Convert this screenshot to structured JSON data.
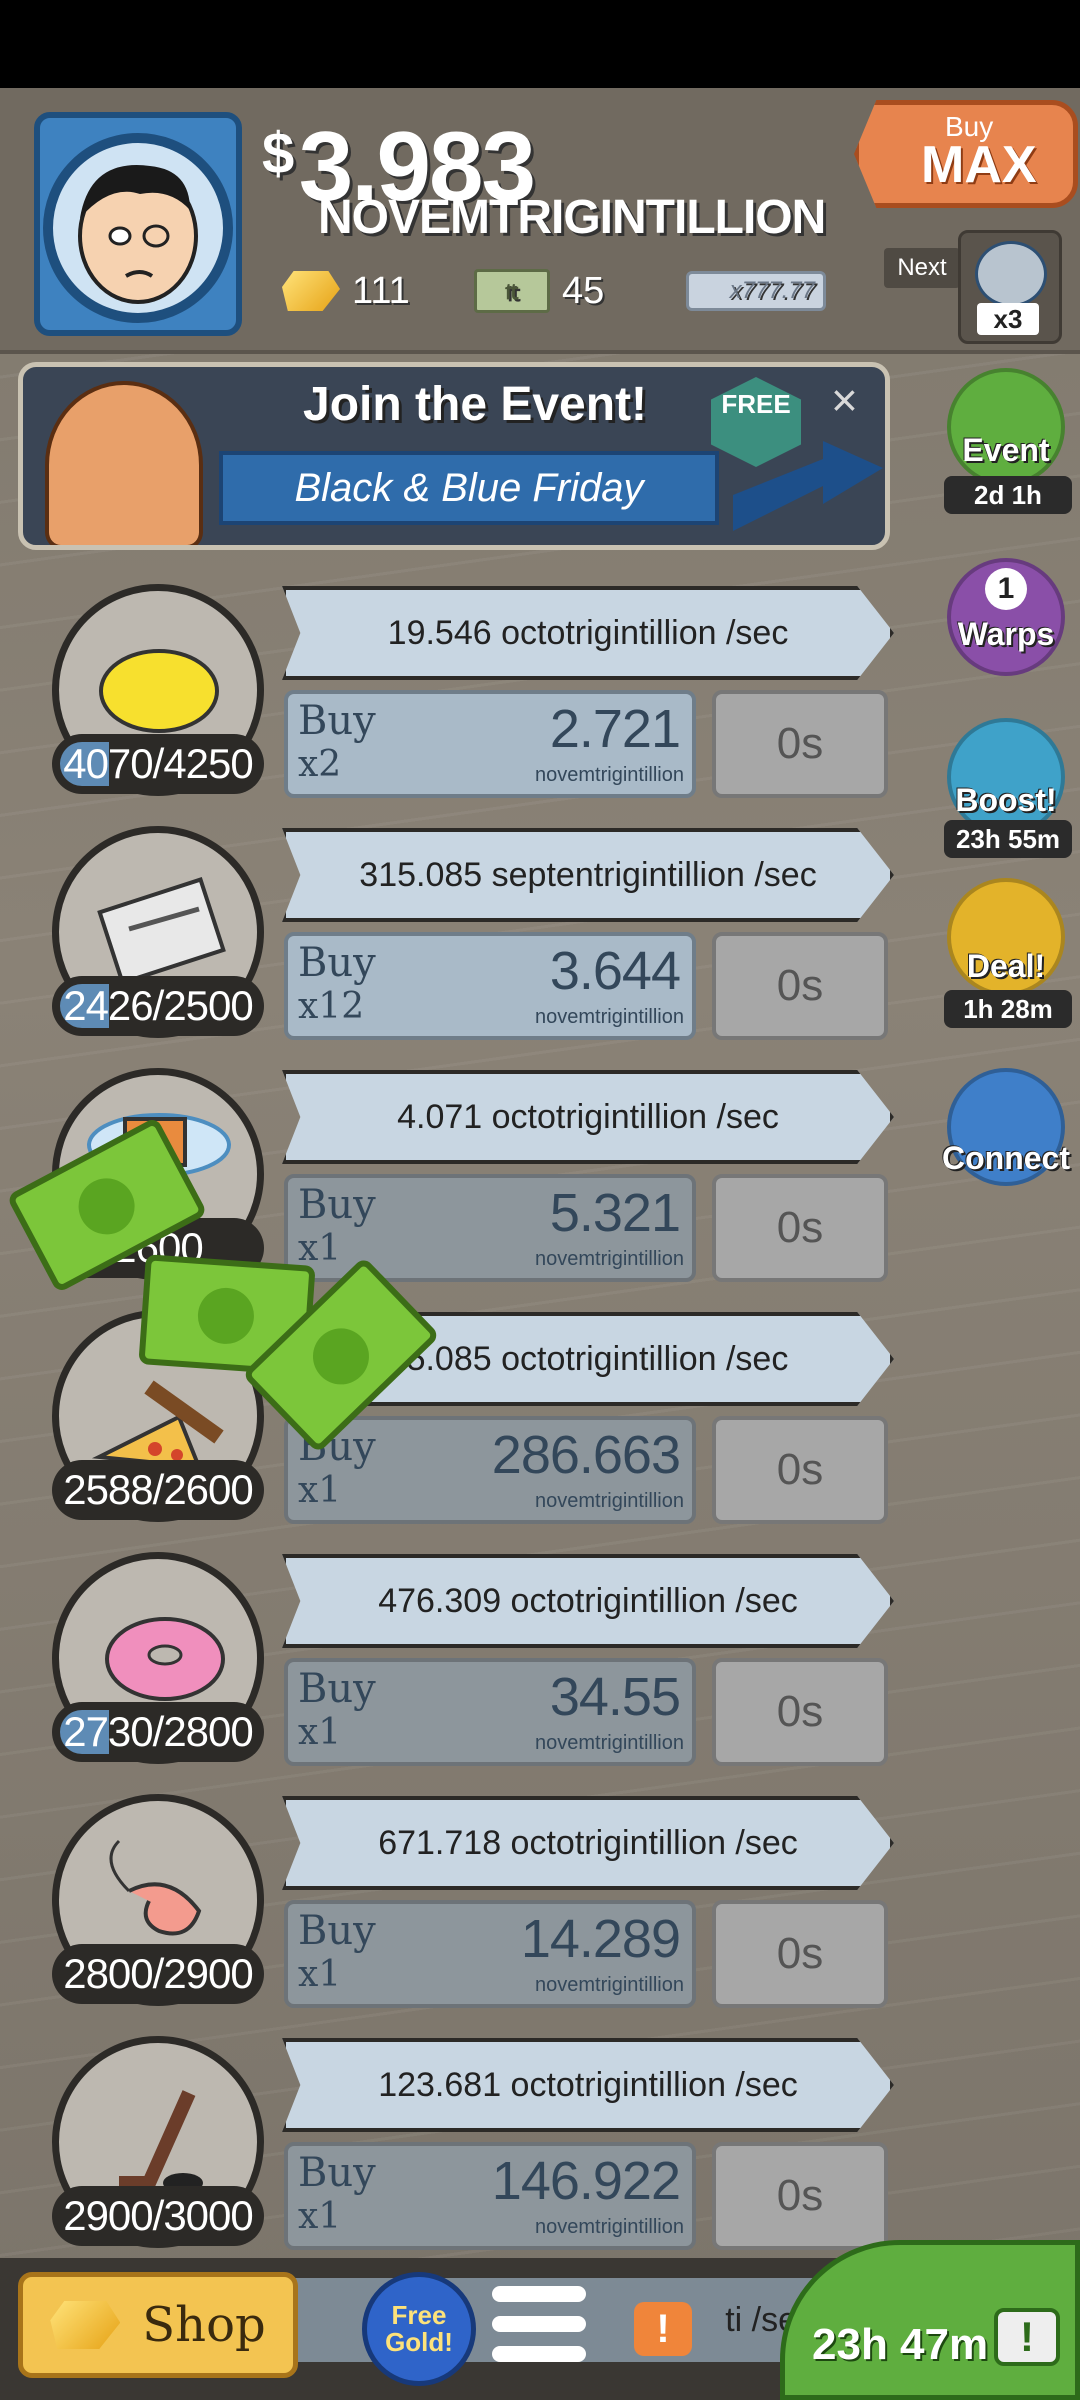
{
  "header": {
    "currency_symbol": "$",
    "amount": "3.983",
    "unit": "NOVEMTRIGINTILLION",
    "gold_count": "111",
    "megabucks_count": "45",
    "bill_multiplier": "x777.77",
    "bill_symbol": "₶",
    "buy_max": {
      "small": "Buy",
      "big": "MAX"
    },
    "next_label": "Next",
    "next_multiplier": "x3"
  },
  "event_banner": {
    "title": "Join the Event!",
    "subtitle": "Black & Blue Friday",
    "free_label": "FREE",
    "close": "×"
  },
  "side_buttons": [
    {
      "label": "Event",
      "timer": "2d 1h",
      "color": "#5fae3f"
    },
    {
      "label": "Warps",
      "badge": "1",
      "color": "#8a4fa8"
    },
    {
      "label": "Boost!",
      "timer": "23h 55m",
      "color": "#3fa2c9"
    },
    {
      "label": "Deal!",
      "timer": "1h 28m",
      "color": "#e3b32a"
    },
    {
      "label": "Connect",
      "color": "#3f7fc9"
    }
  ],
  "businesses": [
    {
      "icon": "lemon-icon",
      "owned": 4070,
      "target": 4250,
      "count_text": "4070/4250",
      "progress": 0.25,
      "rate": "19.546 octotrigintillion /sec",
      "buy_label": "Buy",
      "buy_qty": "x2",
      "price": "2.721",
      "price_unit": "novemtrigintillion",
      "time": "0s",
      "active": true
    },
    {
      "icon": "newspaper-icon",
      "owned": 2426,
      "target": 2500,
      "count_text": "2426/2500",
      "progress": 0.25,
      "rate": "315.085 septentrigintillion /sec",
      "buy_label": "Buy",
      "buy_qty": "x12",
      "price": "3.644",
      "price_unit": "novemtrigintillion",
      "time": "0s",
      "active": true
    },
    {
      "icon": "car-wash-icon",
      "count_text": "2600",
      "rate": "4.071 octotrigintillion /sec",
      "buy_label": "Buy",
      "buy_qty": "x1",
      "price": "5.321",
      "price_unit": "novemtrigintillion",
      "time": "0s",
      "active": false
    },
    {
      "icon": "pizza-icon",
      "owned": 2588,
      "target": 2600,
      "count_text": "2588/2600",
      "progress": 0.0,
      "rate": "25.085 octotrigintillion /sec",
      "buy_label": "Buy",
      "buy_qty": "x1",
      "price": "286.663",
      "price_unit": "novemtrigintillion",
      "time": "0s",
      "active": false
    },
    {
      "icon": "donut-icon",
      "owned": 2730,
      "target": 2800,
      "count_text": "2730/2800",
      "progress": 0.25,
      "rate": "476.309 octotrigintillion /sec",
      "buy_label": "Buy",
      "buy_qty": "x1",
      "price": "34.55",
      "price_unit": "novemtrigintillion",
      "time": "0s",
      "active": false
    },
    {
      "icon": "shrimp-icon",
      "owned": 2800,
      "target": 2900,
      "count_text": "2800/2900",
      "progress": 0.0,
      "rate": "671.718 octotrigintillion /sec",
      "buy_label": "Buy",
      "buy_qty": "x1",
      "price": "14.289",
      "price_unit": "novemtrigintillion",
      "time": "0s",
      "active": false
    },
    {
      "icon": "hockey-icon",
      "owned": 2900,
      "target": 3000,
      "count_text": "2900/3000",
      "progress": 0.0,
      "rate": "123.681 octotrigintillion /sec",
      "buy_label": "Buy",
      "buy_qty": "x1",
      "price": "146.922",
      "price_unit": "novemtrigintillion",
      "time": "0s",
      "active": false
    }
  ],
  "bottom": {
    "shop_label": "Shop",
    "free_gold": "Free Gold!",
    "partial_rate": "ti /sec",
    "alert": "!",
    "tv_timer": "23h 47m",
    "tv_icon": "!"
  }
}
